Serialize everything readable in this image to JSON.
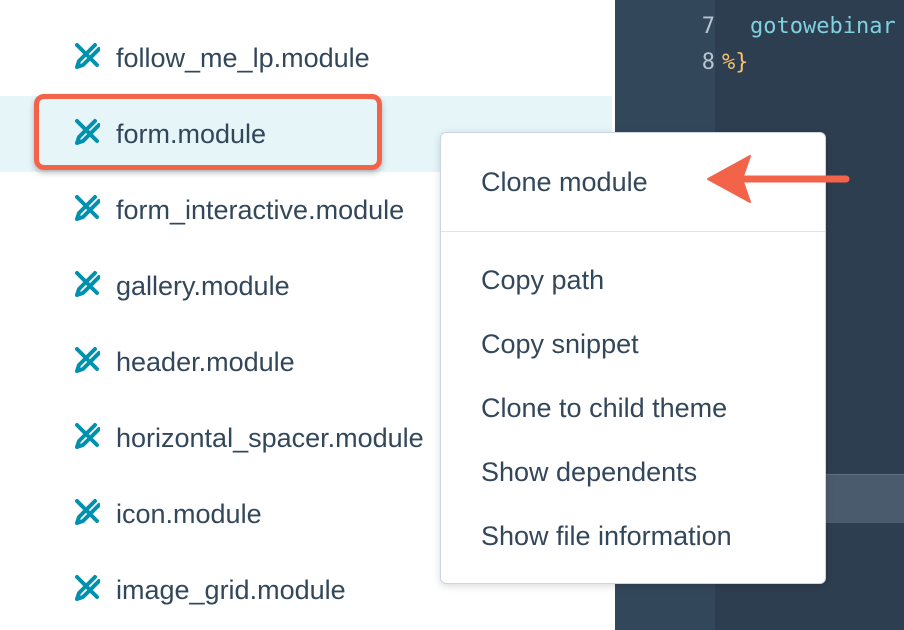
{
  "file_tree": {
    "items": [
      {
        "label": "follow_me_lp.module",
        "icon": "module-tools-icon",
        "selected": false
      },
      {
        "label": "form.module",
        "icon": "module-tools-icon",
        "selected": true
      },
      {
        "label": "form_interactive.module",
        "icon": "module-tools-icon",
        "selected": false
      },
      {
        "label": "gallery.module",
        "icon": "module-tools-icon",
        "selected": false
      },
      {
        "label": "header.module",
        "icon": "module-tools-icon",
        "selected": false
      },
      {
        "label": "horizontal_spacer.module",
        "icon": "module-tools-icon",
        "selected": false
      },
      {
        "label": "icon.module",
        "icon": "module-tools-icon",
        "selected": false
      },
      {
        "label": "image_grid.module",
        "icon": "module-tools-icon",
        "selected": false
      }
    ]
  },
  "editor": {
    "lines": [
      {
        "number": "7",
        "text": "gotowebinar"
      },
      {
        "number": "8",
        "text": "%}"
      }
    ]
  },
  "context_menu": {
    "items": [
      {
        "label": "Clone module"
      },
      {
        "label": "Copy path"
      },
      {
        "label": "Copy snippet"
      },
      {
        "label": "Clone to child theme"
      },
      {
        "label": "Show dependents"
      },
      {
        "label": "Show file information"
      }
    ]
  },
  "colors": {
    "icon": "#0091ae",
    "text": "#33475b",
    "highlight": "#f2634a",
    "selected_row": "#e5f5f8",
    "editor_bg": "#2d3e50"
  }
}
